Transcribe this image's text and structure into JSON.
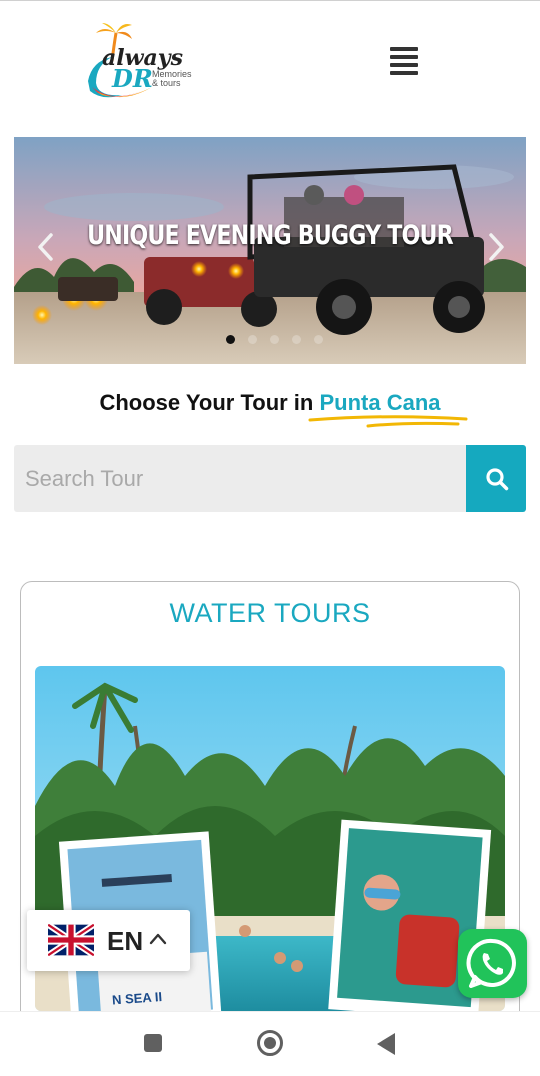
{
  "header": {
    "logo_text_main": "always",
    "logo_text_dr": "DR",
    "logo_tagline_1": "Memories",
    "logo_tagline_2": "& tours",
    "menu_icon": "hamburger-menu-icon"
  },
  "hero": {
    "title": "UNIQUE EVENING BUGGY TOUR",
    "prev_icon": "chevron-left-icon",
    "next_icon": "chevron-right-icon",
    "slide_count": 5,
    "active_slide": 1
  },
  "choose": {
    "prefix": "Choose Your Tour in",
    "highlight": "Punta Cana"
  },
  "search": {
    "placeholder": "Search Tour",
    "value": "",
    "button_icon": "search-icon"
  },
  "card": {
    "title": "WATER TOURS",
    "boat_text": "N SEA II"
  },
  "language": {
    "code": "EN",
    "flag_icon": "uk-flag-icon",
    "caret_icon": "chevron-up-icon"
  },
  "whatsapp": {
    "icon": "whatsapp-icon"
  },
  "navbar": {
    "recents_icon": "square-icon",
    "home_icon": "circle-icon",
    "back_icon": "triangle-back-icon"
  },
  "colors": {
    "accent": "#1aa8c0",
    "search_button": "#15a9bf",
    "underline": "#f2b705",
    "whatsapp": "#21c35a"
  }
}
